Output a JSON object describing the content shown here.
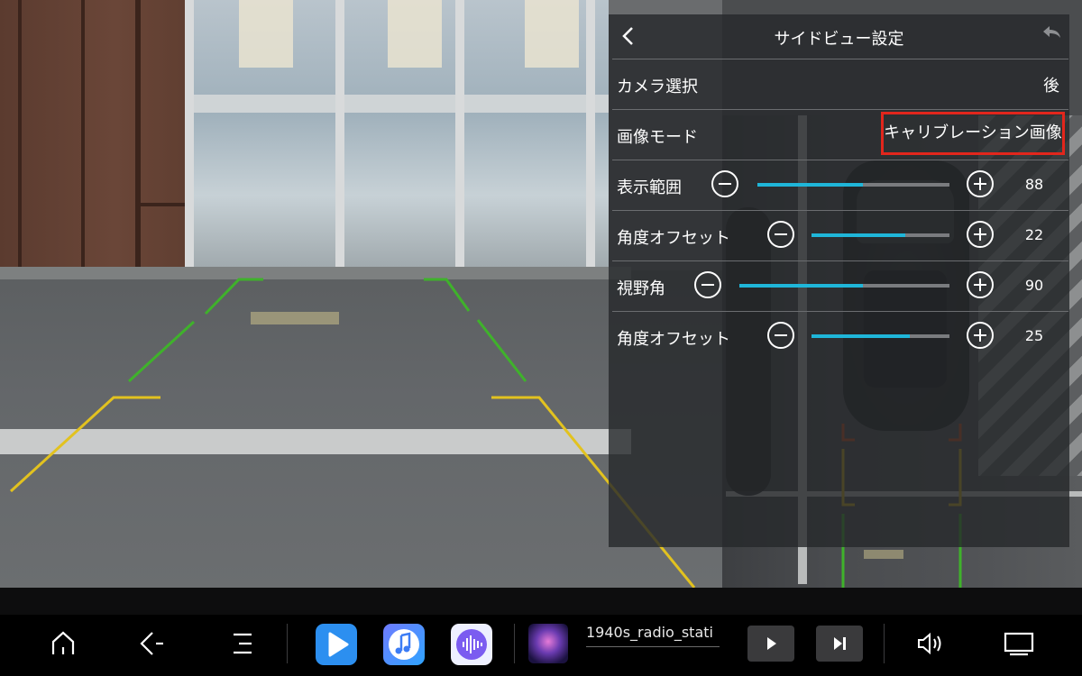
{
  "panel": {
    "title": "サイドビュー設定",
    "rows": [
      {
        "label": "カメラ選択",
        "value": "後"
      },
      {
        "label": "画像モード",
        "value": "キャリブレーション画像"
      },
      {
        "label": "表示範囲",
        "value": "88",
        "level": 0.55
      },
      {
        "label": "角度オフセット",
        "value": "22",
        "level": 0.68
      },
      {
        "label": "視野角",
        "value": "90",
        "level": 0.59
      },
      {
        "label": "角度オフセット",
        "value": "25",
        "level": 0.71
      }
    ],
    "accent_color": "#1fb6d9",
    "highlight_color": "#e2261c"
  },
  "taskbar": {
    "media_title": "1940s_radio_stati",
    "buttons": [
      "home-icon",
      "back-icon",
      "menu-icon",
      "video-player-app",
      "music-app",
      "audio-app",
      "play-icon",
      "next-icon",
      "volume-icon",
      "screen-icon"
    ]
  }
}
